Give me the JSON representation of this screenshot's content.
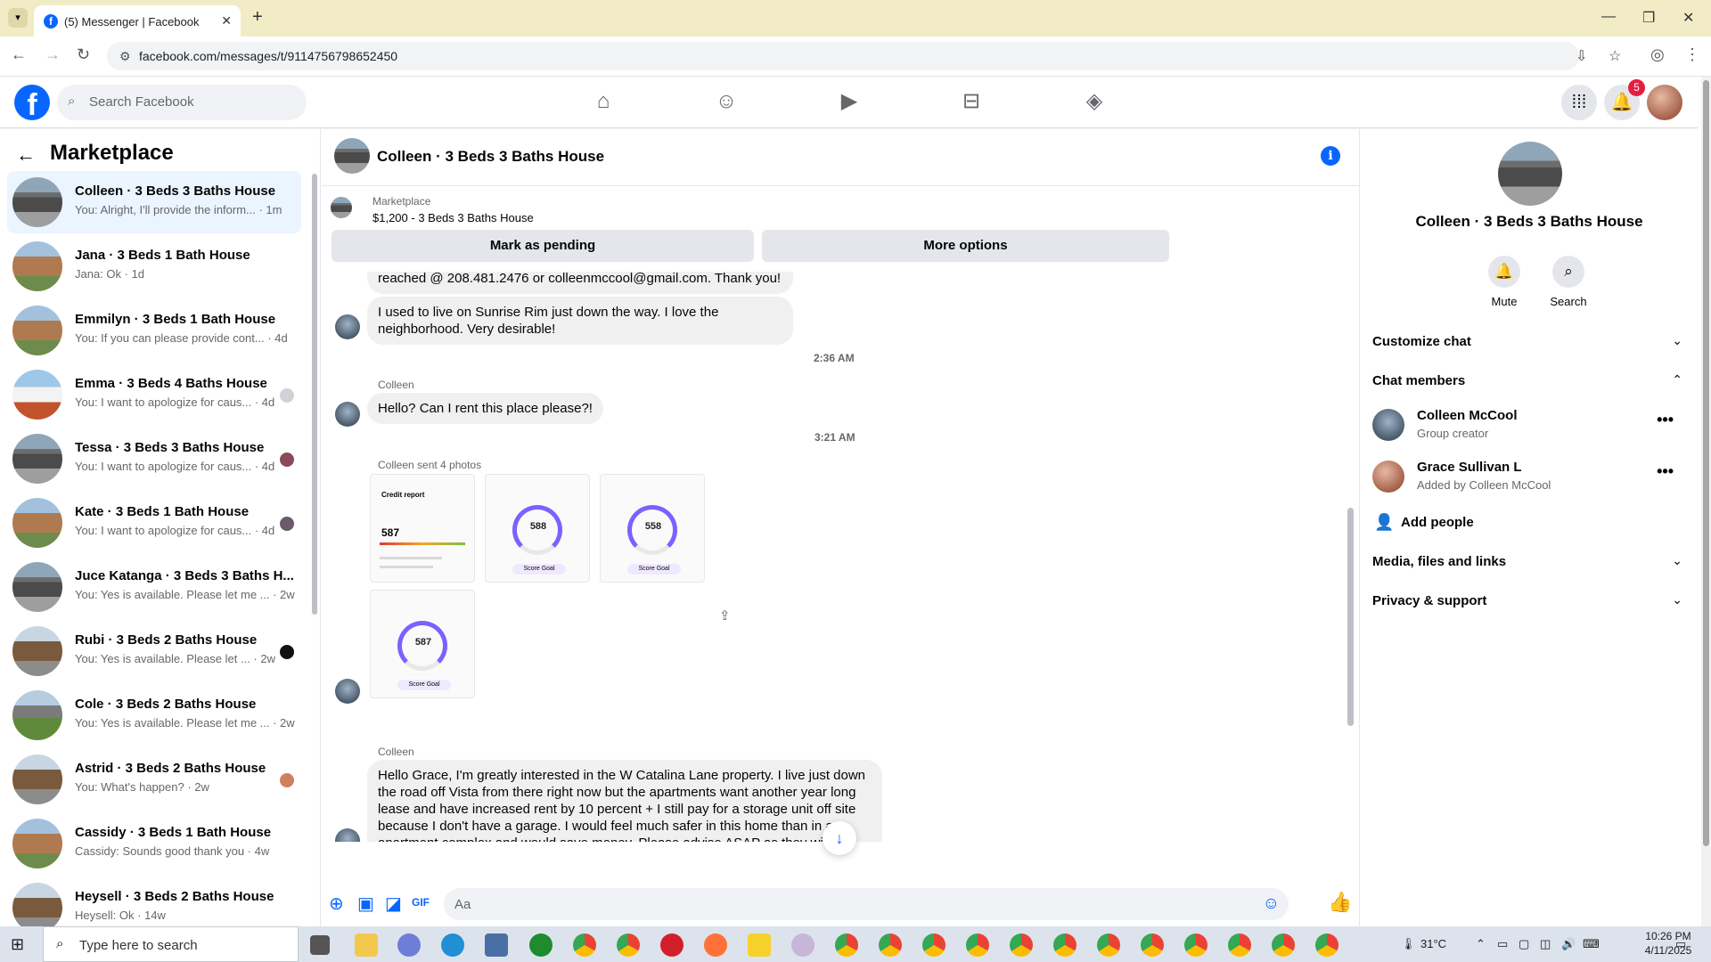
{
  "browser": {
    "tab_title": "(5) Messenger | Facebook",
    "url": "facebook.com/messages/t/9114756798652450"
  },
  "fb": {
    "search_placeholder": "Search Facebook",
    "notification_count": "5"
  },
  "left": {
    "title": "Marketplace",
    "conversations": [
      {
        "name": "Colleen · 3 Beds 3 Baths House",
        "preview": "You: Alright, I'll provide the inform... · 1m"
      },
      {
        "name": "Jana · 3 Beds 1 Bath House",
        "preview": "Jana: Ok · 1d"
      },
      {
        "name": "Emmilyn · 3 Beds 1 Bath House",
        "preview": "You: If you can please provide cont... · 4d"
      },
      {
        "name": "Emma · 3 Beds 4 Baths House",
        "preview": "You: I want to apologize for caus... · 4d"
      },
      {
        "name": "Tessa · 3 Beds 3 Baths House",
        "preview": "You: I want to apologize for caus... · 4d"
      },
      {
        "name": "Kate · 3 Beds 1 Bath House",
        "preview": "You: I want to apologize for caus... · 4d"
      },
      {
        "name": "Juce Katanga · 3 Beds 3 Baths H...",
        "preview": "You: Yes is available. Please let me ... · 2w"
      },
      {
        "name": "Rubi · 3 Beds 2 Baths House",
        "preview": "You: Yes is available. Please let ... · 2w"
      },
      {
        "name": "Cole · 3 Beds 2 Baths House",
        "preview": "You: Yes is available. Please let me ... · 2w"
      },
      {
        "name": "Astrid · 3 Beds 2 Baths House",
        "preview": "You: What's happen? · 2w"
      },
      {
        "name": "Cassidy · 3 Beds 1 Bath House",
        "preview": "Cassidy: Sounds good thank you · 4w"
      },
      {
        "name": "Heysell · 3 Beds 2 Baths House",
        "preview": "Heysell: Ok · 14w"
      }
    ]
  },
  "chat": {
    "title": "Colleen · 3 Beds 3 Baths House",
    "listing_source": "Marketplace",
    "listing": "$1,200 - 3 Beds 3 Baths House",
    "btn_pending": "Mark as pending",
    "btn_more": "More options",
    "msg1": "reached @ 208.481.2476 or colleenmccool@gmail.com. Thank you!",
    "msg2": "I used to live on Sunrise Rim just down the way. I love the neighborhood. Very desirable!",
    "time1": "2:36 AM",
    "sender1": "Colleen",
    "msg3": "Hello? Can I rent this place please?!",
    "time2": "3:21 AM",
    "photos_label": "Colleen sent 4 photos",
    "photo_scores": [
      "587",
      "588",
      "558",
      "587"
    ],
    "photo_credit_label": "Credit report",
    "photo_goal_label": "Score Goal",
    "sender2": "Colleen",
    "msg4": "Hello Grace, I'm greatly interested in the W Catalina Lane property. I live just down the road off Vista from there right now but the apartments want another year long lease and have increased rent by 10 percent + I still pay for a storage unit off site because I don't have a garage. I would feel much safer in this home than in an apartment complex and would save money. Please advise ASAP as they will be wanting me to sign a new lease any day.",
    "composer_placeholder": "Aa"
  },
  "right": {
    "name": "Colleen · 3 Beds 3 Baths House",
    "mute": "Mute",
    "search": "Search",
    "customize": "Customize chat",
    "members_title": "Chat members",
    "members": [
      {
        "name": "Colleen McCool",
        "sub": "Group creator"
      },
      {
        "name": "Grace Sullivan L",
        "sub": "Added by Colleen McCool"
      }
    ],
    "add_people": "Add people",
    "media": "Media, files and links",
    "privacy": "Privacy & support"
  },
  "taskbar": {
    "search_placeholder": "Type here to search",
    "temp": "31°C",
    "time": "10:26 PM",
    "date": "4/11/2025"
  }
}
